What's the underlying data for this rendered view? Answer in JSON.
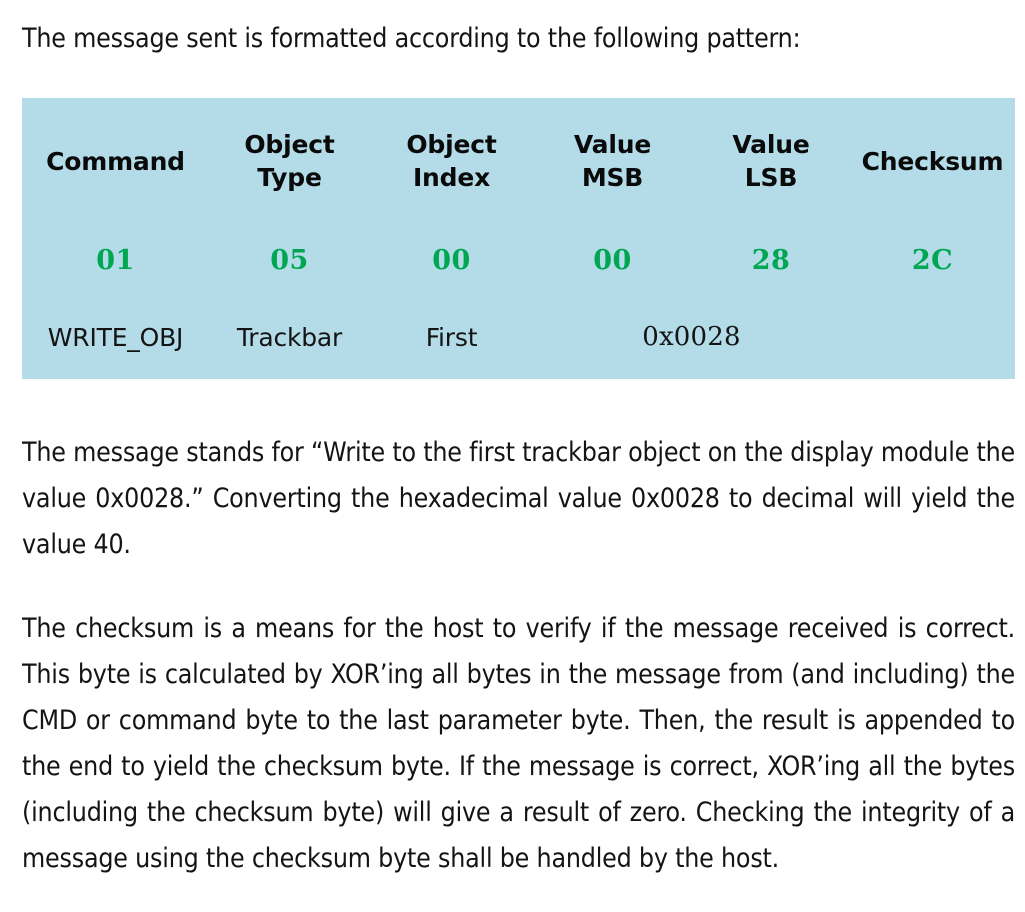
{
  "document": {
    "lead_paragraph": "The message sent is formatted according to the following pattern:",
    "explain_paragraph": "The message stands for “Write to the first trackbar object on the display module the value 0x0028.” Converting the hexadecimal value 0x0028 to decimal will yield the value 40.",
    "checksum_paragraph": "The checksum is a means for the host to verify if the message received is correct. This byte is calculated by XOR’ing all bytes in the message from (and including) the CMD or command byte to the last parameter byte. Then, the result is appended to the end to yield the checksum byte. If the message is correct, XOR’ing all the bytes (including the checksum byte) will give a result of zero. Checking the integrity of a message using the checksum byte shall be handled by the host."
  },
  "message_table": {
    "background_color": "#b3dce8",
    "hex_value_color": "#00a651",
    "header_color": "#0a0a0a",
    "headers": [
      {
        "line1": "Command",
        "line2": ""
      },
      {
        "line1": "Object",
        "line2": "Type"
      },
      {
        "line1": "Object",
        "line2": "Index"
      },
      {
        "line1": "Value",
        "line2": "MSB"
      },
      {
        "line1": "Value",
        "line2": "LSB"
      },
      {
        "line1": "Checksum",
        "line2": ""
      }
    ],
    "hex_values": [
      "01",
      "05",
      "00",
      "00",
      "28",
      "2C"
    ],
    "descriptions": {
      "command": "WRITE_OBJ",
      "object_type": "Trackbar",
      "object_index": "First",
      "value_merged": "0x0028",
      "checksum": ""
    }
  }
}
